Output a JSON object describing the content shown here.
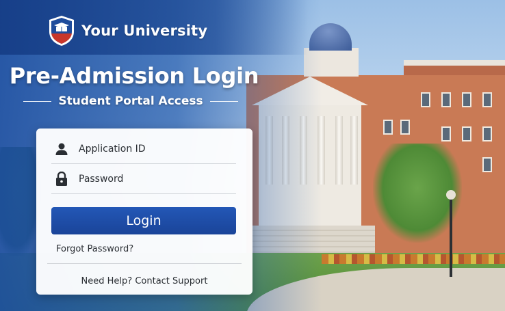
{
  "brand": {
    "name": "Your University",
    "logo_icon": "university-shield-book-icon",
    "colors": {
      "shield_blue": "#1f4c9c",
      "shield_red": "#c8362b"
    }
  },
  "hero": {
    "title": "Pre-Admission Login",
    "subtitle": "Student Portal Access"
  },
  "form": {
    "application_id": {
      "placeholder": "Application ID",
      "value": "",
      "icon": "user-icon"
    },
    "password": {
      "placeholder": "Password",
      "value": "",
      "icon": "lock-icon"
    },
    "login_label": "Login",
    "forgot_label": "Forgot Password?",
    "help_label": "Need Help? Contact Support"
  },
  "colors": {
    "accent": "#1f4ea8",
    "card_bg": "#ffffff"
  }
}
